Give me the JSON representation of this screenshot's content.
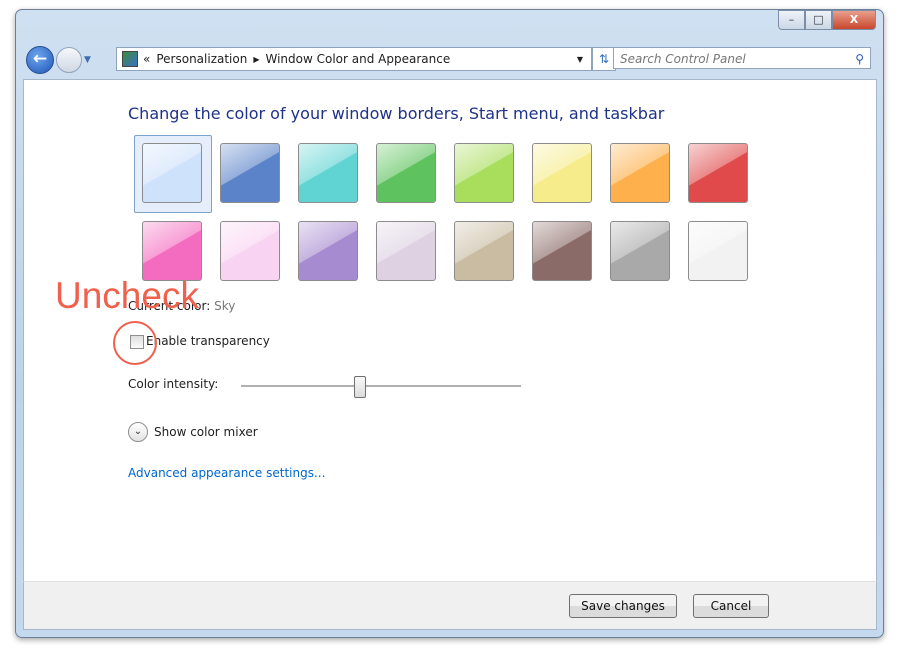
{
  "window": {
    "caption_buttons": [
      "minimize",
      "maximize",
      "close"
    ]
  },
  "nav": {
    "back": "back-icon",
    "forward": "forward-icon"
  },
  "address": {
    "prefix": "«",
    "items": [
      "Personalization",
      "Window Color and Appearance"
    ]
  },
  "search": {
    "placeholder": "Search Control Panel"
  },
  "main": {
    "heading": "Change the color of your window borders, Start menu, and taskbar",
    "swatches": [
      {
        "color": "#cfe2fb",
        "selected": true
      },
      {
        "color": "#5b83c9"
      },
      {
        "color": "#60d3d3"
      },
      {
        "color": "#5ec35e"
      },
      {
        "color": "#a9dd5c"
      },
      {
        "color": "#f6ec8c"
      },
      {
        "color": "#fdb04c"
      },
      {
        "color": "#e04a4a"
      },
      {
        "color": "#f46cc0"
      },
      {
        "color": "#f9d3f2"
      },
      {
        "color": "#a78bd0"
      },
      {
        "color": "#ddd1e2"
      },
      {
        "color": "#c9bca2"
      },
      {
        "color": "#8b6b67"
      },
      {
        "color": "#a9a9a9"
      },
      {
        "color": "#f2f2f2"
      }
    ],
    "current_color_label": "Current color:",
    "current_color_value": "Sky",
    "transparency_label": "Enable transparency",
    "transparency_checked": false,
    "intensity_label": "Color intensity:",
    "intensity_value": 0.42,
    "mixer_label": "Show color mixer",
    "advanced_link": "Advanced appearance settings..."
  },
  "footer": {
    "save": "Save changes",
    "cancel": "Cancel"
  },
  "annotation": {
    "text": "Uncheck",
    "color": "#f0604d"
  }
}
